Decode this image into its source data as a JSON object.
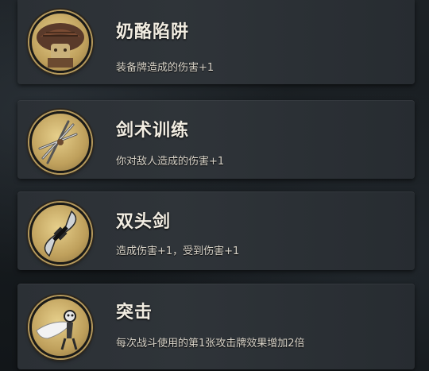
{
  "cards": [
    {
      "title": "奶酪陷阱",
      "desc": "装备牌造成的伤害+1",
      "icon": "cheese-trap-icon"
    },
    {
      "title": "剑术训练",
      "desc": "你对敌人造成的伤害+1",
      "icon": "sword-training-icon"
    },
    {
      "title": "双头剑",
      "desc": "造成伤害+1，受到伤害+1",
      "icon": "double-blade-icon"
    },
    {
      "title": "突击",
      "desc": "每次战斗使用的第1张攻击牌效果增加2倍",
      "icon": "assault-icon"
    }
  ],
  "colors": {
    "card_bg": "#2f3439",
    "orb_gold": "#bfa05c",
    "title": "#f2ede2",
    "desc": "#d9d4c9"
  }
}
